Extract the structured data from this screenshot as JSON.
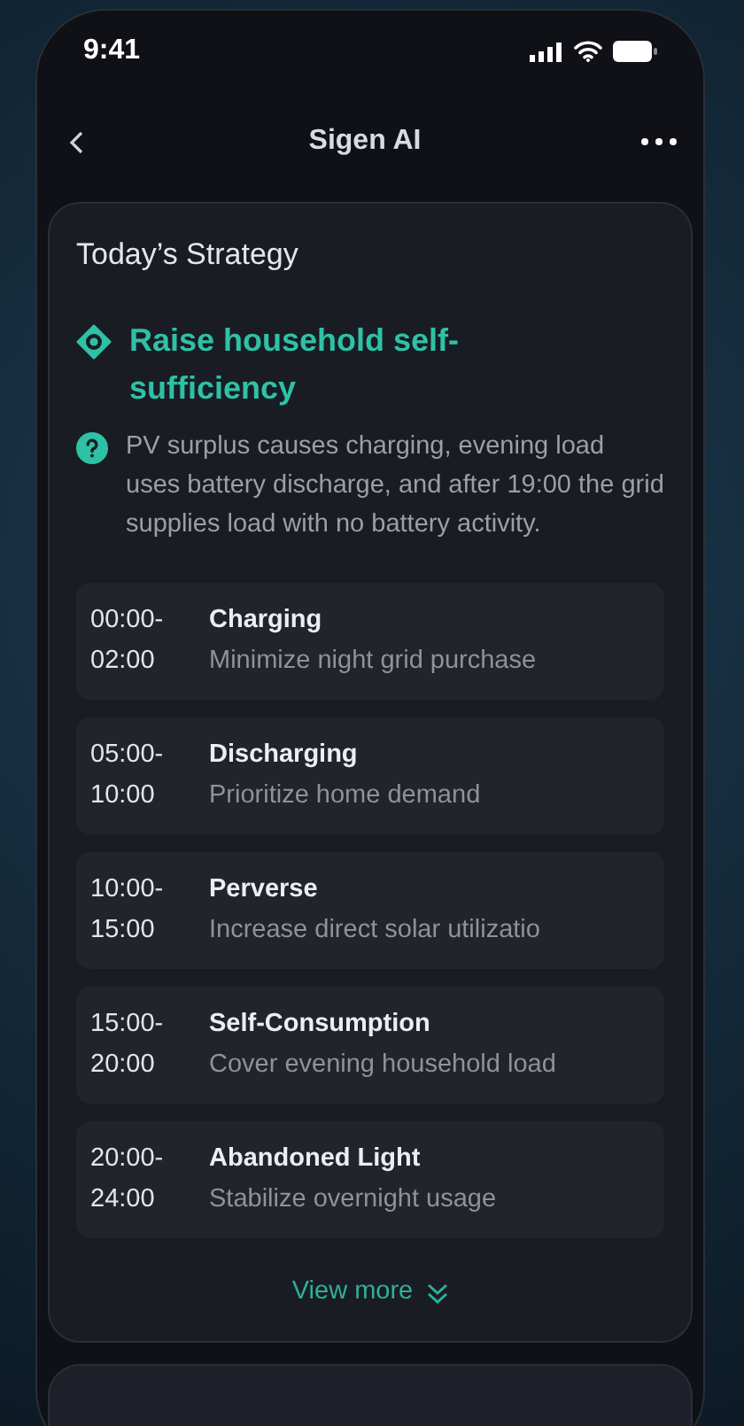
{
  "status_bar": {
    "time": "9:41"
  },
  "nav": {
    "title": "Sigen AI"
  },
  "strategy": {
    "title": "Today’s Strategy",
    "goal": "Raise household self-sufficiency",
    "description": "PV surplus causes charging, evening load uses battery discharge, and after 19:00 the grid supplies load with no battery activity.",
    "schedule": [
      {
        "start": "00:00-",
        "end": "02:00",
        "mode": "Charging",
        "detail": "Minimize night grid purchase"
      },
      {
        "start": "05:00-",
        "end": "10:00",
        "mode": "Discharging",
        "detail": "Prioritize home demand"
      },
      {
        "start": "10:00-",
        "end": "15:00",
        "mode": "Perverse",
        "detail": "Increase direct solar utilizatio"
      },
      {
        "start": "15:00-",
        "end": "20:00",
        "mode": "Self-Consumption",
        "detail": "Cover evening household load"
      },
      {
        "start": "20:00-",
        "end": "24:00",
        "mode": "Abandoned Light",
        "detail": "Stabilize overnight usage"
      }
    ],
    "view_more": "View more"
  }
}
